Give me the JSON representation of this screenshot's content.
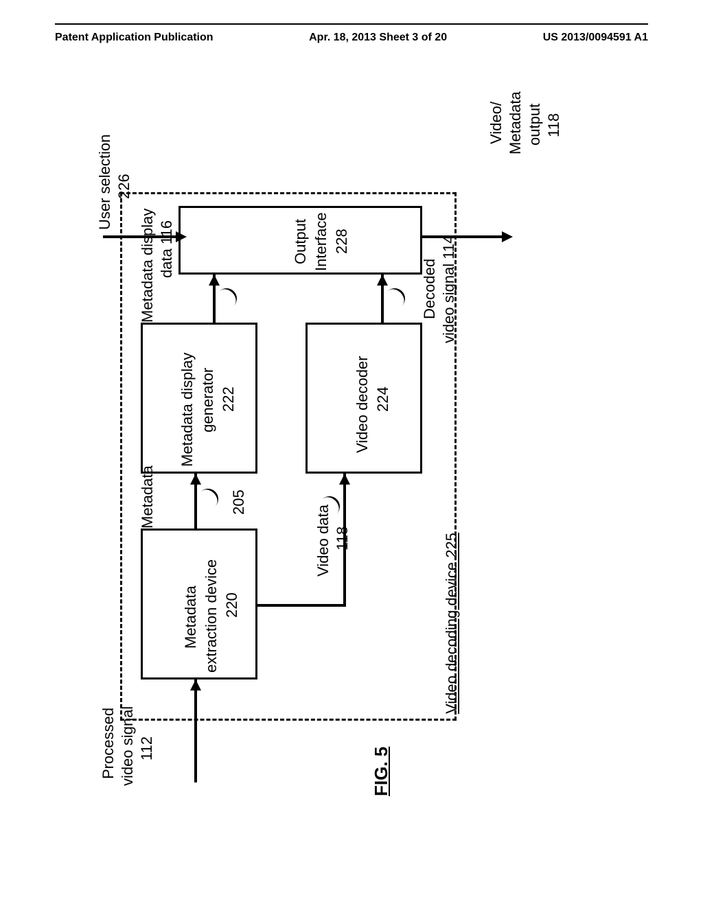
{
  "header": {
    "left": "Patent Application Publication",
    "center": "Apr. 18, 2013  Sheet 3 of 20",
    "right": "US 2013/0094591 A1"
  },
  "figure_label": "FIG. 5",
  "inputs": {
    "processed_video_signal": {
      "l1": "Processed",
      "l2": "video signal",
      "num": "112"
    },
    "user_selection": {
      "l1": "User selection",
      "num": "226"
    }
  },
  "outputs": {
    "video_metadata_output": {
      "l1": "Video/",
      "l2": "Metadata",
      "l3": "output",
      "num": "118"
    }
  },
  "blocks": {
    "metadata_extraction": {
      "l1": "Metadata",
      "l2": "extraction device",
      "num": "220"
    },
    "metadata_display_gen": {
      "l1": "Metadata display",
      "l2": "generator",
      "num": "222"
    },
    "video_decoder": {
      "l1": "Video decoder",
      "num": "224"
    },
    "output_interface": {
      "l1": "Output",
      "l2": "Interface",
      "num": "228"
    }
  },
  "signals": {
    "metadata": {
      "l1": "Metadata",
      "num": "205"
    },
    "video_data": {
      "l1": "Video data",
      "num": "118"
    },
    "metadata_display_data": {
      "l1": "Metadata display",
      "l2": "data 116"
    },
    "decoded_video_signal": {
      "l1": "Decoded",
      "l2": "video signal 114"
    }
  },
  "container_label": "Video decoding device 225"
}
